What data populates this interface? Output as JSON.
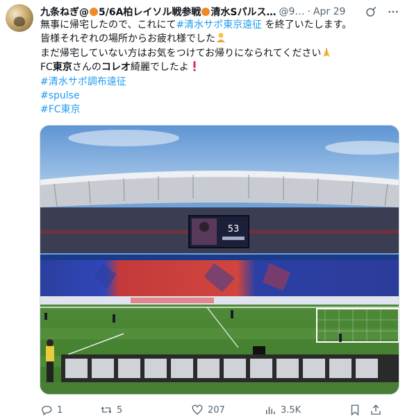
{
  "tweet": {
    "display_name": "九条ねぎ@",
    "display_name_part2": "5/6A柏レイソル戦参戦",
    "display_name_part3": "清水Sパルス…",
    "handle": "@9…",
    "separator": "·",
    "date": "Apr 29",
    "text": {
      "l1_a": "無事に帰宅したので、これにて",
      "l1_link": "#清水サポ東京遠征",
      "l1_b": "を終了いたします。",
      "l2": "皆様それぞれの場所からお疲れ様でした",
      "l3": "まだ帰宅していない方はお気をつけてお帰りになられてください",
      "l4_a": "FC",
      "l4_b": "東京",
      "l4_c": "さんの",
      "l4_d": "コレオ",
      "l4_e": "綺麗でしたよ",
      "tag1": "#清水サポ調布遠征",
      "tag2": "#spulse",
      "tag3": "#FC東京"
    },
    "scoreboard_number": "53",
    "actions": {
      "replies": "1",
      "reposts": "5",
      "likes": "207",
      "views": "3.5K"
    }
  },
  "colors": {
    "link": "#1d9bf0",
    "muted": "#536471",
    "text": "#0f1419"
  }
}
